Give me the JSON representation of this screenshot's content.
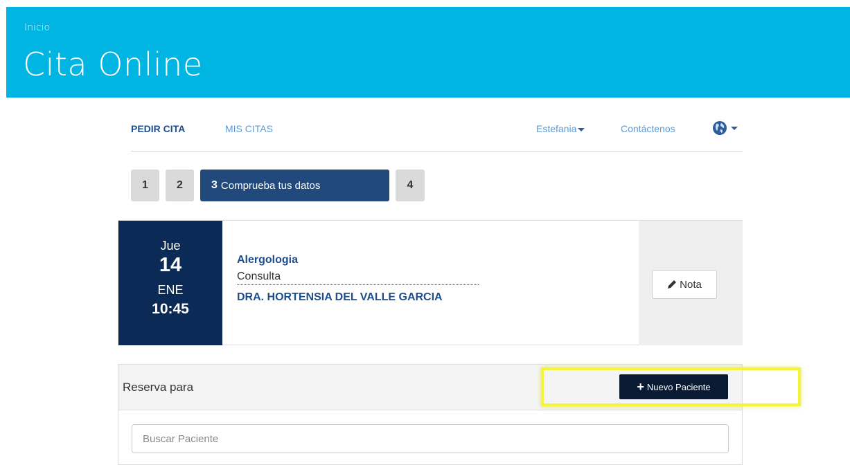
{
  "header": {
    "breadcrumb": "Inicio",
    "title": "Cita Online",
    "background_color": "#00b5e2"
  },
  "nav": {
    "pedir_cita": "PEDIR CITA",
    "mis_citas": "MIS CITAS",
    "user": "Estefania",
    "contact": "Contáctenos",
    "language_icon": "globe-icon"
  },
  "steps": [
    {
      "number": "1"
    },
    {
      "number": "2"
    },
    {
      "number": "3",
      "label": "Comprueba tus datos",
      "active": true
    },
    {
      "number": "4"
    }
  ],
  "appointment": {
    "weekday": "Jue",
    "day": "14",
    "month": "ENE",
    "time": "10:45",
    "specialty": "Alergologia",
    "type": "Consulta",
    "doctor": "DRA. HORTENSIA DEL VALLE GARCIA",
    "note_button": "Nota",
    "note_icon": "pencil-icon"
  },
  "booking": {
    "title": "Reserva para",
    "new_patient_button": "Nuevo Paciente",
    "new_patient_icon": "plus-icon",
    "search_placeholder": "Buscar Paciente",
    "highlight_color": "#f4f43a"
  }
}
